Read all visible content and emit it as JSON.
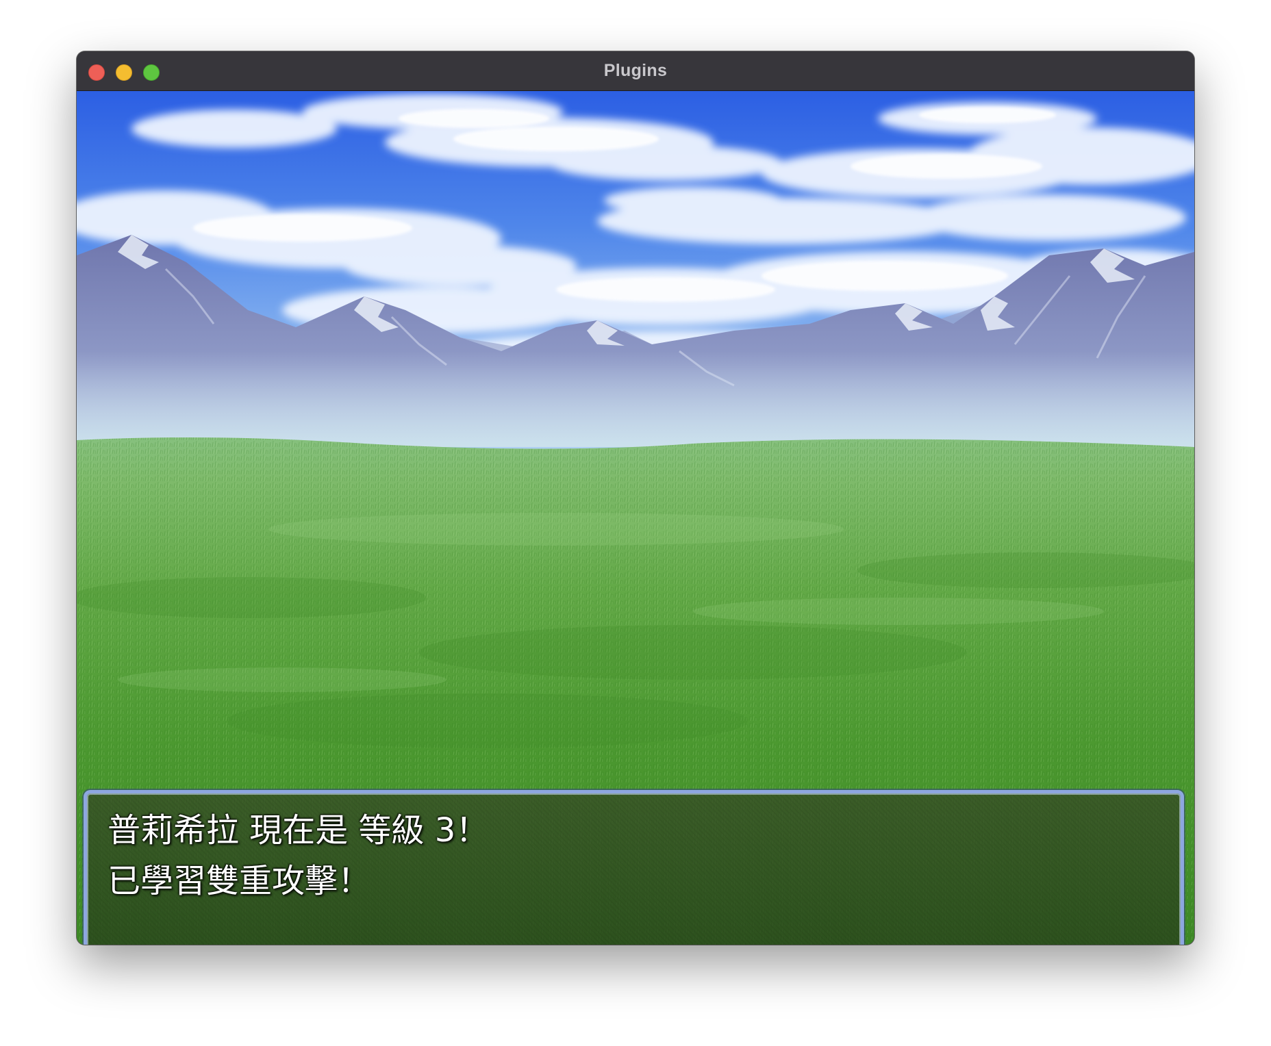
{
  "window": {
    "title": "Plugins",
    "controls": [
      "close",
      "minimize",
      "maximize"
    ]
  },
  "scene": {
    "background": "grassland with snowy mountains and cloudy blue sky"
  },
  "message": {
    "lines": [
      "普莉希拉 現在是 等級 3！",
      "已學習雙重攻擊！"
    ],
    "continue_icon": "down-triangle-icon"
  },
  "colors": {
    "window_border": "#8ea7e0",
    "message_text": "#ffffff",
    "sky_top": "#2f64e6",
    "grass": "#4f9a2e"
  }
}
